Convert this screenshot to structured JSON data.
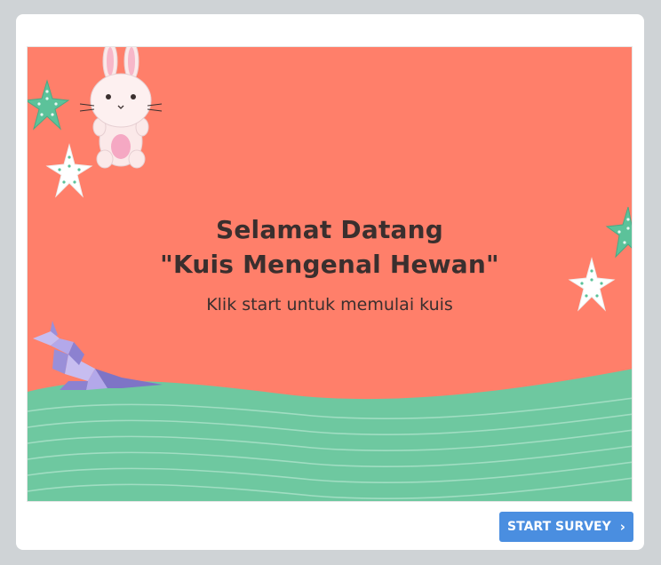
{
  "slide": {
    "title_line1": "Selamat Datang",
    "title_line2": "\"Kuis Mengenal Hewan\"",
    "subtitle": "Klik start untuk memulai kuis",
    "background_color": "#ff7f6a",
    "ground_color": "#6ec8a0"
  },
  "footer": {
    "start_label": "START SURVEY",
    "start_icon": "chevron-right-icon",
    "button_color": "#4a8ee0"
  },
  "decorations": [
    "bunny-illustration",
    "starfish-icon",
    "kangaroo-origami-illustration"
  ]
}
